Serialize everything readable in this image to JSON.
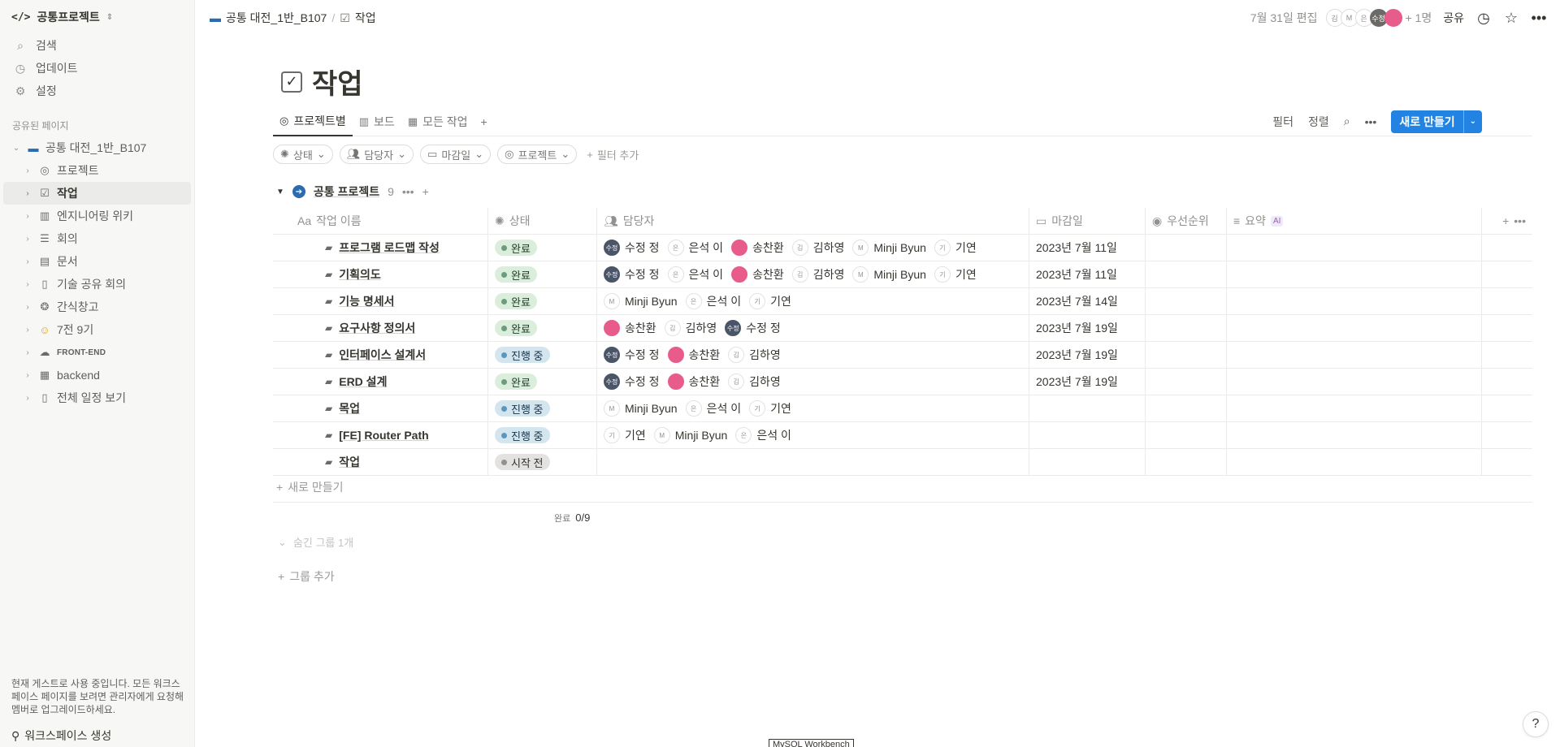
{
  "workspace": {
    "name": "공통프로젝트",
    "icon": "code-icon"
  },
  "nav": {
    "search": "검색",
    "updates": "업데이트",
    "settings": "설정"
  },
  "sidebar": {
    "section_label": "공유된 페이지",
    "root": "공통 대전_1반_B107",
    "items": [
      {
        "label": "프로젝트",
        "icon": "target-icon"
      },
      {
        "label": "작업",
        "icon": "checkbox-icon"
      },
      {
        "label": "엔지니어링 위키",
        "icon": "book-icon"
      },
      {
        "label": "회의",
        "icon": "list-icon"
      },
      {
        "label": "문서",
        "icon": "doc-icon"
      },
      {
        "label": "기술 공유 회의",
        "icon": "page-icon"
      },
      {
        "label": "간식창고",
        "icon": "snack-icon"
      },
      {
        "label": "7전 9기",
        "icon": "person-icon"
      },
      {
        "label": "FRONT-END",
        "icon": "cloud-icon"
      },
      {
        "label": "backend",
        "icon": "table-icon"
      },
      {
        "label": "전체 일정 보기",
        "icon": "page-icon"
      }
    ],
    "guest_note": "현재 게스트로 사용 중입니다. 모든 워크스페이스 페이지를 보려면 관리자에게 요청해 멤버로 업그레이드하세요.",
    "create_workspace": "워크스페이스 생성"
  },
  "topbar": {
    "breadcrumb_root": "공통 대전_1반_B107",
    "breadcrumb_sep": "/",
    "breadcrumb_current": "작업",
    "edited": "7월 31일 편집",
    "avatars": [
      "김",
      "M",
      "은",
      "수정"
    ],
    "more_people": "+ 1명",
    "share": "공유"
  },
  "page": {
    "title": "작업"
  },
  "views": {
    "tabs": [
      {
        "label": "프로젝트별",
        "icon": "target-icon"
      },
      {
        "label": "보드",
        "icon": "board-icon"
      },
      {
        "label": "모든 작업",
        "icon": "table-icon"
      }
    ],
    "filter": "필터",
    "sort": "정렬",
    "new": "새로 만들기"
  },
  "filters": {
    "chips": [
      "상태",
      "담당자",
      "마감일",
      "프로젝트"
    ],
    "add": "필터 추가"
  },
  "group": {
    "name": "공통 프로젝트",
    "count": "9"
  },
  "columns": {
    "name": "작업 이름",
    "name_prefix": "Aa",
    "status": "상태",
    "assignee": "담당자",
    "due": "마감일",
    "priority": "우선순위",
    "summary": "요약",
    "summary_badge": "AI"
  },
  "rows": [
    {
      "name": "프로그램 로드맵 작성",
      "status": "완료",
      "status_kind": "done",
      "assignees": [
        {
          "av": "수정",
          "name": "수정 정",
          "style": "dark"
        },
        {
          "av": "은",
          "name": "은석 이",
          "style": "light"
        },
        {
          "av": "",
          "name": "송찬환",
          "style": "pink"
        },
        {
          "av": "김",
          "name": "김하영",
          "style": "light"
        },
        {
          "av": "M",
          "name": "Minji Byun",
          "style": "light"
        },
        {
          "av": "기",
          "name": "기연",
          "style": "light"
        }
      ],
      "due": "2023년 7월 11일"
    },
    {
      "name": "기획의도",
      "status": "완료",
      "status_kind": "done",
      "assignees": [
        {
          "av": "수정",
          "name": "수정 정",
          "style": "dark"
        },
        {
          "av": "은",
          "name": "은석 이",
          "style": "light"
        },
        {
          "av": "",
          "name": "송찬환",
          "style": "pink"
        },
        {
          "av": "김",
          "name": "김하영",
          "style": "light"
        },
        {
          "av": "M",
          "name": "Minji Byun",
          "style": "light"
        },
        {
          "av": "기",
          "name": "기연",
          "style": "light"
        }
      ],
      "due": "2023년 7월 11일"
    },
    {
      "name": "기능 명세서",
      "status": "완료",
      "status_kind": "done",
      "assignees": [
        {
          "av": "M",
          "name": "Minji Byun",
          "style": "light"
        },
        {
          "av": "은",
          "name": "은석 이",
          "style": "light"
        },
        {
          "av": "기",
          "name": "기연",
          "style": "light"
        }
      ],
      "due": "2023년 7월 14일"
    },
    {
      "name": "요구사항 정의서",
      "status": "완료",
      "status_kind": "done",
      "assignees": [
        {
          "av": "",
          "name": "송찬환",
          "style": "pink"
        },
        {
          "av": "김",
          "name": "김하영",
          "style": "light"
        },
        {
          "av": "수정",
          "name": "수정 정",
          "style": "dark"
        }
      ],
      "due": "2023년 7월 19일"
    },
    {
      "name": "인터페이스 설계서",
      "status": "진행 중",
      "status_kind": "prog",
      "assignees": [
        {
          "av": "수정",
          "name": "수정 정",
          "style": "dark"
        },
        {
          "av": "",
          "name": "송찬환",
          "style": "pink"
        },
        {
          "av": "김",
          "name": "김하영",
          "style": "light"
        }
      ],
      "due": "2023년 7월 19일"
    },
    {
      "name": "ERD 설계",
      "status": "완료",
      "status_kind": "done",
      "assignees": [
        {
          "av": "수정",
          "name": "수정 정",
          "style": "dark"
        },
        {
          "av": "",
          "name": "송찬환",
          "style": "pink"
        },
        {
          "av": "김",
          "name": "김하영",
          "style": "light"
        }
      ],
      "due": "2023년 7월 19일"
    },
    {
      "name": "목업",
      "status": "진행 중",
      "status_kind": "prog",
      "assignees": [
        {
          "av": "M",
          "name": "Minji Byun",
          "style": "light"
        },
        {
          "av": "은",
          "name": "은석 이",
          "style": "light"
        },
        {
          "av": "기",
          "name": "기연",
          "style": "light"
        }
      ],
      "due": ""
    },
    {
      "name": "[FE] Router Path",
      "status": "진행 중",
      "status_kind": "prog",
      "assignees": [
        {
          "av": "기",
          "name": "기연",
          "style": "light"
        },
        {
          "av": "M",
          "name": "Minji Byun",
          "style": "light"
        },
        {
          "av": "은",
          "name": "은석 이",
          "style": "light"
        }
      ],
      "due": ""
    },
    {
      "name": "작업",
      "status": "시작 전",
      "status_kind": "todo",
      "assignees": [],
      "due": ""
    }
  ],
  "footer": {
    "new_row": "새로 만들기",
    "calc_label": "완료",
    "calc_value": "0/9",
    "hidden_groups": "숨긴 그룹 1개",
    "add_group": "그룹 추가",
    "help": "?",
    "taskbar_tip": "MySQL Workbench"
  },
  "colors": {
    "accent": "#2383e2",
    "done": "#dbeddb",
    "progress": "#d3e5ef",
    "todo": "#e3e2e0"
  }
}
